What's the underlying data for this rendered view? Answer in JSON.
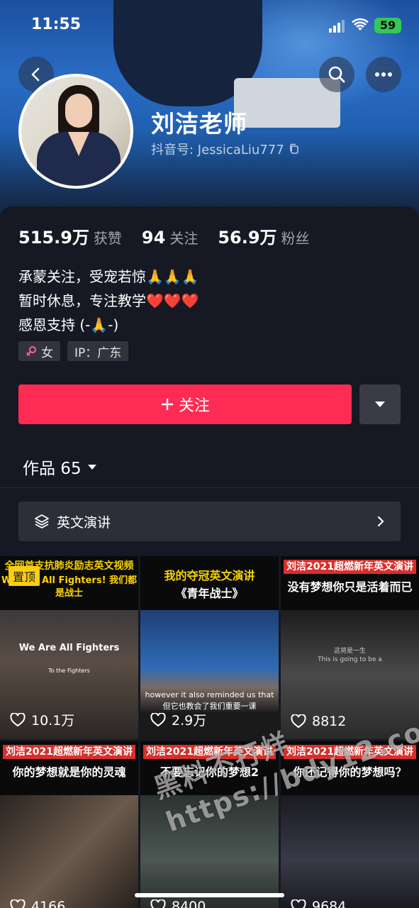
{
  "status_bar": {
    "time": "11:55",
    "battery": "59"
  },
  "profile": {
    "name": "刘洁老师",
    "douyin_id": "抖音号: JessicaLiu777"
  },
  "stats": [
    {
      "value": "515.9万",
      "label": "获赞"
    },
    {
      "value": "94",
      "label": "关注"
    },
    {
      "value": "56.9万",
      "label": "粉丝"
    }
  ],
  "bio": [
    "承蒙关注，受宠若惊🙏🙏🙏",
    "暂时休息，专注教学❤️❤️❤️",
    "感恩支持 (-🙏-)"
  ],
  "tags": {
    "gender": "女",
    "ip": "IP：广东"
  },
  "follow_label": "关注",
  "works_label": "作品 65",
  "collection_label": "英文演讲",
  "videos": [
    {
      "l1": "全网首支抗肺炎励志英文视频",
      "l2": "We Are All Fighters! 我们都是战士",
      "likes": "10.1万",
      "pinned": "置顶",
      "caption1": "We Are All Fighters",
      "caption2": "To the Fighters"
    },
    {
      "l1": "我的夺冠英文演讲",
      "l2": "《青年战士》",
      "likes": "2.9万",
      "caption1": "however it also reminded us that",
      "caption2": "但它也教会了我们重要一课"
    },
    {
      "l1": "刘洁2021超燃新年英文演讲",
      "l2": "没有梦想你只是活着而已",
      "likes": "8812",
      "caption1": "这将是一生",
      "caption2": "This is going to be a"
    },
    {
      "l1": "刘洁2021超燃新年英文演讲",
      "l2": "你的梦想就是你的灵魂",
      "likes": "4166"
    },
    {
      "l1": "刘洁2021超燃新年英文演讲",
      "l2": "不要忘记你的梦想2",
      "likes": "8400"
    },
    {
      "l1": "刘洁2021超燃新年英文演讲",
      "l2": "你还记得你的梦想吗？",
      "likes": "9684"
    }
  ],
  "watermark": {
    "line1": "黑料不打烊",
    "line2": "https://bdy12.co"
  }
}
